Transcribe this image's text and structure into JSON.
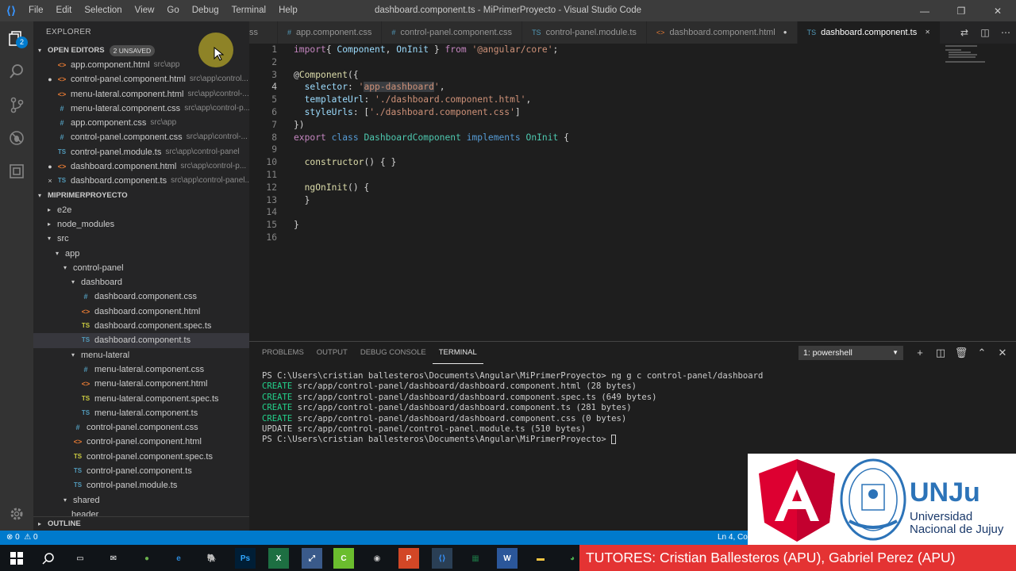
{
  "app": {
    "window_title": "dashboard.component.ts - MiPrimerProyecto - Visual Studio Code",
    "menu": [
      "File",
      "Edit",
      "Selection",
      "View",
      "Go",
      "Debug",
      "Terminal",
      "Help"
    ],
    "activity_badge": "2"
  },
  "sidebar": {
    "title": "EXPLORER",
    "open_editors": {
      "label": "OPEN EDITORS",
      "unsaved": "2 UNSAVED",
      "items": [
        {
          "status": "",
          "icon": "<>",
          "kind": "html",
          "name": "app.component.html",
          "path": "src\\app"
        },
        {
          "status": "●",
          "icon": "<>",
          "kind": "html",
          "name": "control-panel.component.html",
          "path": "src\\app\\control..."
        },
        {
          "status": "",
          "icon": "<>",
          "kind": "html",
          "name": "menu-lateral.component.html",
          "path": "src\\app\\control-..."
        },
        {
          "status": "",
          "icon": "#",
          "kind": "css",
          "name": "menu-lateral.component.css",
          "path": "src\\app\\control-p..."
        },
        {
          "status": "",
          "icon": "#",
          "kind": "css",
          "name": "app.component.css",
          "path": "src\\app"
        },
        {
          "status": "",
          "icon": "#",
          "kind": "css",
          "name": "control-panel.component.css",
          "path": "src\\app\\control-..."
        },
        {
          "status": "",
          "icon": "TS",
          "kind": "ts",
          "name": "control-panel.module.ts",
          "path": "src\\app\\control-panel"
        },
        {
          "status": "●",
          "icon": "<>",
          "kind": "html",
          "name": "dashboard.component.html",
          "path": "src\\app\\control-p..."
        },
        {
          "status": "×",
          "icon": "TS",
          "kind": "ts",
          "name": "dashboard.component.ts",
          "path": "src\\app\\control-panel..."
        }
      ]
    },
    "project": {
      "label": "MIPRIMERPROYECTO",
      "tree": [
        {
          "twisty": "▸",
          "icon": "",
          "kind": "",
          "name": "e2e",
          "indent": 0
        },
        {
          "twisty": "▸",
          "icon": "",
          "kind": "",
          "name": "node_modules",
          "indent": 0
        },
        {
          "twisty": "▾",
          "icon": "",
          "kind": "",
          "name": "src",
          "indent": 0
        },
        {
          "twisty": "▾",
          "icon": "",
          "kind": "",
          "name": "app",
          "indent": 1
        },
        {
          "twisty": "▾",
          "icon": "",
          "kind": "",
          "name": "control-panel",
          "indent": 2
        },
        {
          "twisty": "▾",
          "icon": "",
          "kind": "",
          "name": "dashboard",
          "indent": 3
        },
        {
          "twisty": "",
          "icon": "#",
          "kind": "css",
          "name": "dashboard.component.css",
          "indent": 4
        },
        {
          "twisty": "",
          "icon": "<>",
          "kind": "html",
          "name": "dashboard.component.html",
          "indent": 4
        },
        {
          "twisty": "",
          "icon": "TS",
          "kind": "spec",
          "name": "dashboard.component.spec.ts",
          "indent": 4
        },
        {
          "twisty": "",
          "icon": "TS",
          "kind": "ts",
          "name": "dashboard.component.ts",
          "indent": 4,
          "selected": true
        },
        {
          "twisty": "▾",
          "icon": "",
          "kind": "",
          "name": "menu-lateral",
          "indent": 3
        },
        {
          "twisty": "",
          "icon": "#",
          "kind": "css",
          "name": "menu-lateral.component.css",
          "indent": 4
        },
        {
          "twisty": "",
          "icon": "<>",
          "kind": "html",
          "name": "menu-lateral.component.html",
          "indent": 4
        },
        {
          "twisty": "",
          "icon": "TS",
          "kind": "spec",
          "name": "menu-lateral.component.spec.ts",
          "indent": 4
        },
        {
          "twisty": "",
          "icon": "TS",
          "kind": "ts",
          "name": "menu-lateral.component.ts",
          "indent": 4
        },
        {
          "twisty": "",
          "icon": "#",
          "kind": "css",
          "name": "control-panel.component.css",
          "indent": 3
        },
        {
          "twisty": "",
          "icon": "<>",
          "kind": "html",
          "name": "control-panel.component.html",
          "indent": 3
        },
        {
          "twisty": "",
          "icon": "TS",
          "kind": "spec",
          "name": "control-panel.component.spec.ts",
          "indent": 3
        },
        {
          "twisty": "",
          "icon": "TS",
          "kind": "ts",
          "name": "control-panel.component.ts",
          "indent": 3
        },
        {
          "twisty": "",
          "icon": "TS",
          "kind": "ts",
          "name": "control-panel.module.ts",
          "indent": 3
        },
        {
          "twisty": "▾",
          "icon": "",
          "kind": "",
          "name": "shared",
          "indent": 2
        },
        {
          "twisty": "",
          "icon": "",
          "kind": "",
          "name": "header",
          "indent": 3
        }
      ]
    },
    "outline_label": "OUTLINE"
  },
  "tabs": [
    {
      "icon": "",
      "name": "ss",
      "active": false,
      "dirty": false
    },
    {
      "icon": "#",
      "name": "app.component.css",
      "active": false,
      "dirty": false
    },
    {
      "icon": "#",
      "name": "control-panel.component.css",
      "active": false,
      "dirty": false
    },
    {
      "icon": "TS",
      "name": "control-panel.module.ts",
      "active": false,
      "dirty": false
    },
    {
      "icon": "<>",
      "name": "dashboard.component.html",
      "active": false,
      "dirty": true
    },
    {
      "icon": "TS",
      "name": "dashboard.component.ts",
      "active": true,
      "dirty": false
    }
  ],
  "editor": {
    "current_line": 4,
    "lines": [
      [
        [
          "kw",
          "import"
        ],
        [
          "",
          "{ "
        ],
        [
          "var",
          "Component"
        ],
        [
          "",
          ", "
        ],
        [
          "var",
          "OnInit"
        ],
        [
          "",
          "",
          " } "
        ],
        [
          "kw",
          "from"
        ],
        [
          "",
          " "
        ],
        [
          "str",
          "'@angular/core'"
        ],
        [
          "",
          ";"
        ]
      ],
      [],
      [
        [
          "",
          "@"
        ],
        [
          "dec",
          "Component"
        ],
        [
          "",
          "({"
        ]
      ],
      [
        [
          "",
          "  "
        ],
        [
          "var",
          "selector"
        ],
        [
          "",
          ": "
        ],
        [
          "str",
          "'"
        ],
        [
          "strhl",
          "app-dashboard"
        ],
        [
          "str",
          "'"
        ],
        [
          "",
          ","
        ]
      ],
      [
        [
          "",
          "  "
        ],
        [
          "var",
          "templateUrl"
        ],
        [
          "",
          ": "
        ],
        [
          "str",
          "'./dashboard.component.html'"
        ],
        [
          "",
          ","
        ]
      ],
      [
        [
          "",
          "  "
        ],
        [
          "var",
          "styleUrls"
        ],
        [
          "",
          ": ["
        ],
        [
          "str",
          "'./dashboard.component.css'"
        ],
        [
          "",
          "]"
        ]
      ],
      [
        [
          "",
          "})"
        ]
      ],
      [
        [
          "kw",
          "export"
        ],
        [
          "",
          " "
        ],
        [
          "kb",
          "class"
        ],
        [
          "",
          " "
        ],
        [
          "cls",
          "DashboardComponent"
        ],
        [
          "",
          " "
        ],
        [
          "kb",
          "implements"
        ],
        [
          "",
          " "
        ],
        [
          "cls",
          "OnInit"
        ],
        [
          "",
          " {"
        ]
      ],
      [],
      [
        [
          "",
          "  "
        ],
        [
          "fn",
          "constructor"
        ],
        [
          "",
          "() { }"
        ]
      ],
      [],
      [
        [
          "",
          "  "
        ],
        [
          "fn",
          "ngOnInit"
        ],
        [
          "",
          "() {"
        ]
      ],
      [
        [
          "",
          "  }"
        ]
      ],
      [],
      [
        [
          "",
          "}"
        ]
      ],
      []
    ]
  },
  "panel": {
    "tabs": [
      "PROBLEMS",
      "OUTPUT",
      "DEBUG CONSOLE",
      "TERMINAL"
    ],
    "active_tab": "TERMINAL",
    "terminal_select": "1: powershell",
    "terminal_lines": [
      {
        "prefix": "",
        "text": "PS C:\\Users\\cristian ballesteros\\Documents\\Angular\\MiPrimerProyecto> ng g c control-panel/dashboard"
      },
      {
        "prefix": "CREATE",
        "text": " src/app/control-panel/dashboard/dashboard.component.html (28 bytes)"
      },
      {
        "prefix": "CREATE",
        "text": " src/app/control-panel/dashboard/dashboard.component.spec.ts (649 bytes)"
      },
      {
        "prefix": "CREATE",
        "text": " src/app/control-panel/dashboard/dashboard.component.ts (281 bytes)"
      },
      {
        "prefix": "CREATE",
        "text": " src/app/control-panel/dashboard/dashboard.component.css (0 bytes)"
      },
      {
        "prefix": "",
        "text": "UPDATE src/app/control-panel/control-panel.module.ts (510 bytes)"
      },
      {
        "prefix": "",
        "text": "PS C:\\Users\\cristian ballesteros\\Documents\\Angular\\MiPrimerProyecto> "
      }
    ]
  },
  "status": {
    "errors": "⊗ 0",
    "warnings": "⚠ 0",
    "position": "Ln 4, Col"
  },
  "overlay": {
    "tutors": "TUTORES: Cristian Ballesteros (APU), Gabriel Perez (APU)",
    "unju_short": "UNJu",
    "unju_line1": "Universidad",
    "unju_line2": "Nacional de Jujuy",
    "seal_text": "UNIVERSIDAD NACIONAL DE JUJUY"
  },
  "colors": {
    "accent": "#007acc",
    "tutor_banner": "#e43333",
    "angular_red": "#dd0031"
  }
}
